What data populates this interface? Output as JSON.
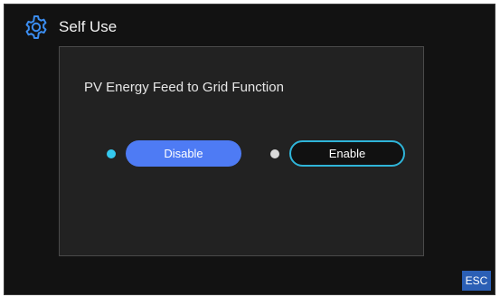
{
  "header": {
    "title": "Self Use",
    "icon": "gear-icon"
  },
  "panel": {
    "label": "PV Energy Feed to Grid Function",
    "options": [
      {
        "label": "Disable",
        "selected": true
      },
      {
        "label": "Enable",
        "selected": false
      }
    ]
  },
  "footer": {
    "esc_label": "ESC"
  },
  "colors": {
    "background": "#121212",
    "panel": "#222222",
    "selected_button": "#4e7bf4",
    "outline_button_border": "#2fb4d8",
    "active_dot": "#34c9ef",
    "inactive_dot": "#d9d9d9",
    "esc_button": "#2b5fb5",
    "gear_icon": "#3b8df0"
  }
}
